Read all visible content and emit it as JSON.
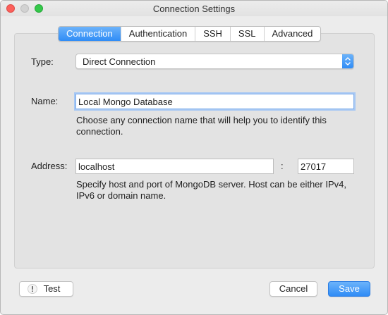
{
  "window": {
    "title": "Connection Settings"
  },
  "tabs": [
    {
      "label": "Connection",
      "active": true
    },
    {
      "label": "Authentication",
      "active": false
    },
    {
      "label": "SSH",
      "active": false
    },
    {
      "label": "SSL",
      "active": false
    },
    {
      "label": "Advanced",
      "active": false
    }
  ],
  "form": {
    "type_label": "Type:",
    "type_value": "Direct Connection",
    "name_label": "Name:",
    "name_value": "Local Mongo Database",
    "name_help": "Choose any connection name that will help you to identify this connection.",
    "address_label": "Address:",
    "host_value": "localhost",
    "port_separator": ":",
    "port_value": "27017",
    "address_help": "Specify host and port of MongoDB server. Host can be either IPv4, IPv6 or domain name."
  },
  "buttons": {
    "test": "Test",
    "cancel": "Cancel",
    "save": "Save"
  },
  "colors": {
    "accent": "#2f8cf6",
    "close": "#fc605b",
    "maximize": "#34c84a"
  },
  "icons": [
    "close-icon",
    "minimize-icon",
    "maximize-icon",
    "select-stepper-icon",
    "warning-icon"
  ]
}
